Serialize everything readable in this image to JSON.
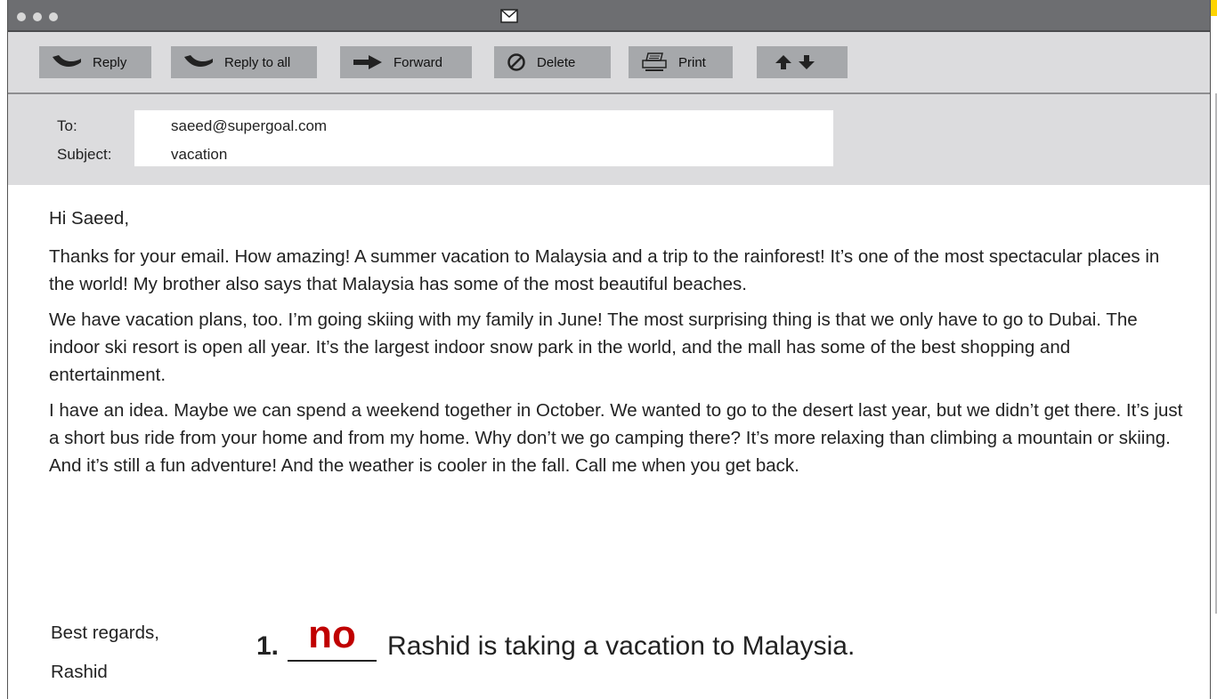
{
  "window": {
    "title_icon": "envelope-icon"
  },
  "toolbar": {
    "reply": "Reply",
    "reply_all": "Reply to all",
    "forward": "Forward",
    "delete": "Delete",
    "print": "Print"
  },
  "header": {
    "to_label": "To:",
    "to_value": "saeed@supergoal.com",
    "subject_label": "Subject:",
    "subject_value": "vacation"
  },
  "email": {
    "greeting": "Hi Saeed,",
    "paragraphs": [
      "Thanks for your email. How amazing! A summer vacation to Malaysia and a trip to the rainforest! It’s one of the most spectacular places in the world! My brother also says that Malaysia has some of the most beautiful beaches.",
      "We have vacation plans, too. I’m going skiing with my family in June! The most surprising thing is that we only have to go to Dubai. The indoor ski resort is open all year. It’s the largest indoor snow park in the world, and the mall has some of the best shopping and entertainment.",
      "I have an idea. Maybe we can spend a weekend together in October. We wanted to go to the desert last year, but we didn’t get there. It’s just a short bus ride from your home and from my home. Why don’t we go camping there? It’s more relaxing than climbing a mountain or skiing. And it’s still a fun adventure! And the weather is cooler in the fall. Call me when you get back."
    ],
    "closing": "Best regards,",
    "signature": "Rashid"
  },
  "question": {
    "number": "1.",
    "answer": "no",
    "text": "Rashid is taking a vacation to Malaysia."
  },
  "colors": {
    "answer": "#c00000",
    "toolbar_button": "#a6a8ab",
    "title_bar": "#6d6e71"
  }
}
